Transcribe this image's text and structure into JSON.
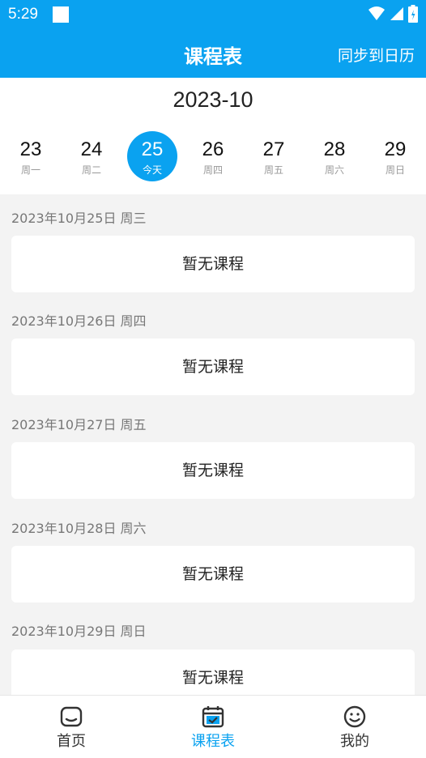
{
  "status_bar": {
    "time": "5:29"
  },
  "app_bar": {
    "title": "课程表",
    "sync_label": "同步到日历"
  },
  "calendar": {
    "month": "2023-10",
    "days": [
      {
        "num": "23",
        "label": "周一"
      },
      {
        "num": "24",
        "label": "周二"
      },
      {
        "num": "25",
        "label": "今天"
      },
      {
        "num": "26",
        "label": "周四"
      },
      {
        "num": "27",
        "label": "周五"
      },
      {
        "num": "28",
        "label": "周六"
      },
      {
        "num": "29",
        "label": "周日"
      }
    ]
  },
  "schedule": [
    {
      "date": "2023年10月25日 周三",
      "text": "暂无课程"
    },
    {
      "date": "2023年10月26日 周四",
      "text": "暂无课程"
    },
    {
      "date": "2023年10月27日 周五",
      "text": "暂无课程"
    },
    {
      "date": "2023年10月28日 周六",
      "text": "暂无课程"
    },
    {
      "date": "2023年10月29日 周日",
      "text": "暂无课程"
    }
  ],
  "tab_bar": {
    "home": "首页",
    "schedule": "课程表",
    "mine": "我的"
  },
  "colors": {
    "accent": "#0aa2f0"
  }
}
